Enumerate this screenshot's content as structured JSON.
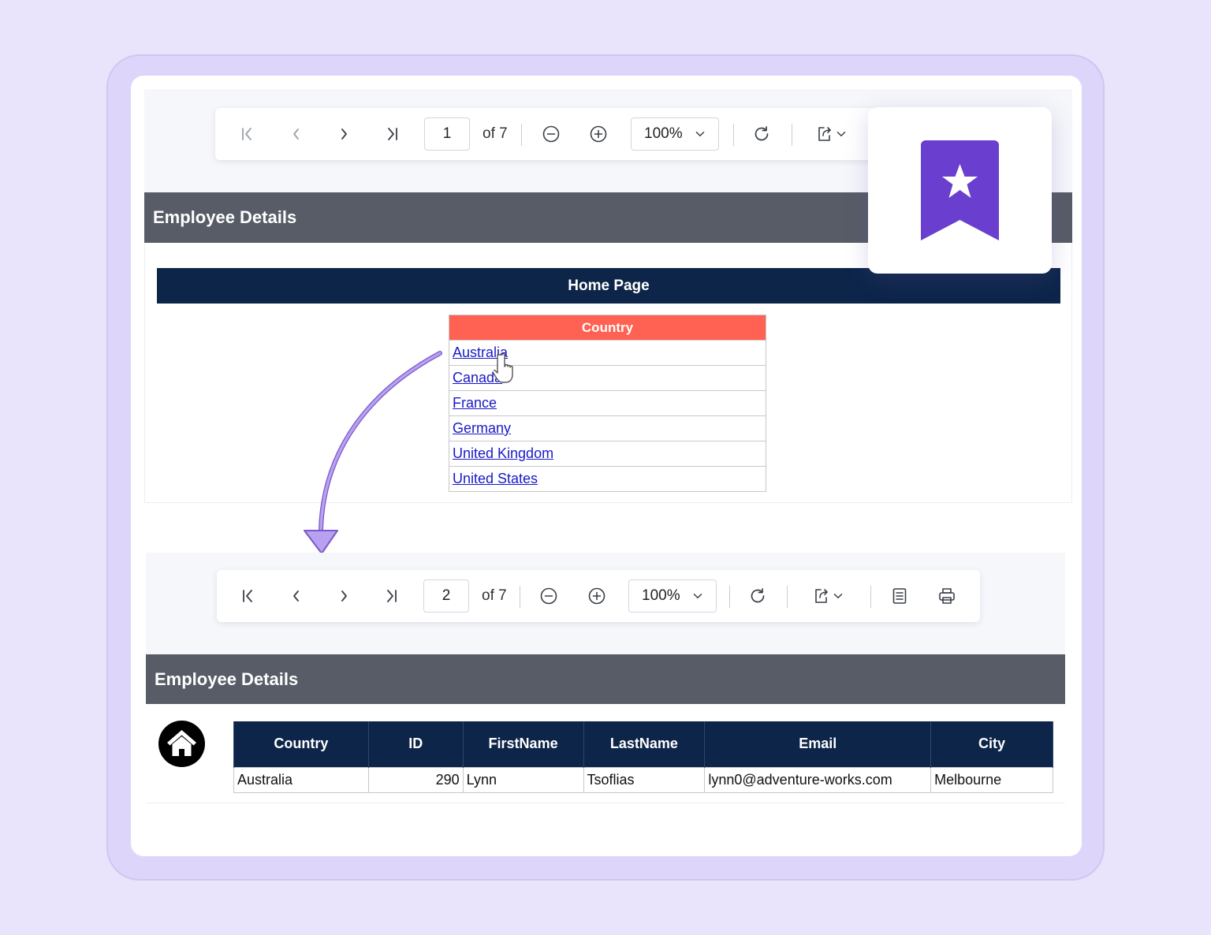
{
  "viewer1": {
    "toolbar": {
      "page_value": "1",
      "of_text": "of 7",
      "zoom_value": "100%"
    },
    "header_title": "Employee Details",
    "home_banner": "Home Page",
    "country_table": {
      "header": "Country",
      "rows": [
        "Australia",
        "Canada",
        "France",
        "Germany",
        "United Kingdom",
        "United States"
      ]
    }
  },
  "viewer2": {
    "toolbar": {
      "page_value": "2",
      "of_text": "of 7",
      "zoom_value": "100%"
    },
    "header_title": "Employee Details",
    "employee_table": {
      "columns": [
        "Country",
        "ID",
        "FirstName",
        "LastName",
        "Email",
        "City"
      ],
      "rows": [
        [
          "Australia",
          "290",
          "Lynn",
          "Tsoflias",
          "lynn0@adventure-works.com",
          "Melbourne"
        ]
      ]
    }
  },
  "icons": {
    "bookmark": "bookmark-star-icon",
    "home": "home-icon",
    "cursor": "hand-pointer-icon"
  },
  "colors": {
    "accent_purple": "#6a3fcf",
    "navy": "#0d2549",
    "header_gray": "#575c66",
    "country_header": "#ff6152",
    "link_blue": "#1919c8"
  }
}
